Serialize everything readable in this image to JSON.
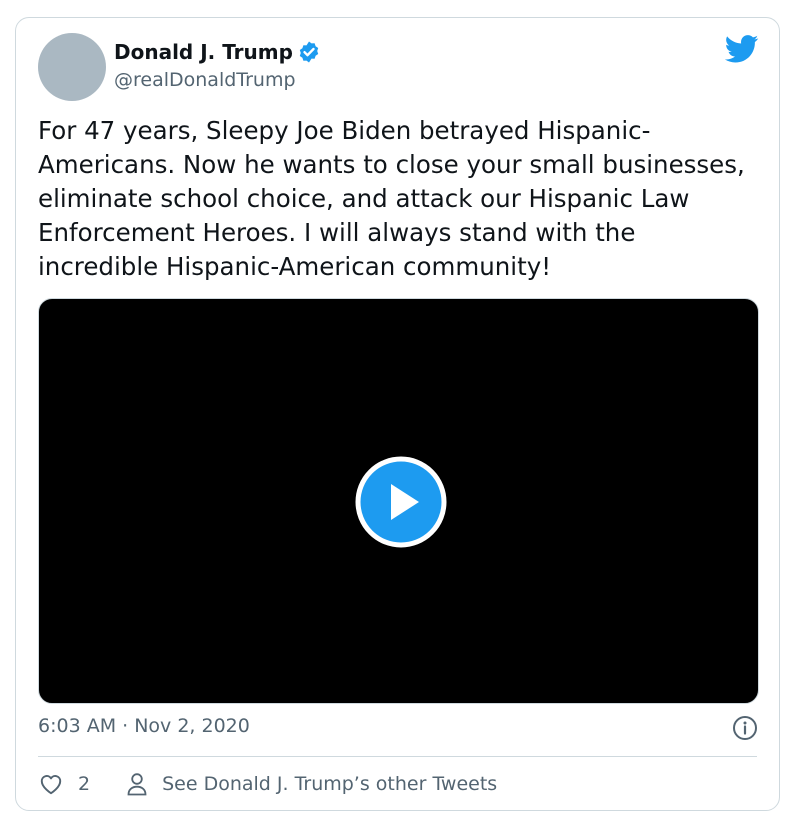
{
  "author": {
    "display_name": "Donald J. Trump",
    "handle": "@realDonaldTrump",
    "verified": true
  },
  "tweet": {
    "text": "For 47 years, Sleepy Joe Biden betrayed Hispanic-Americans. Now he wants to close your small businesses, eliminate school choice, and attack our Hispanic Law Enforcement Heroes. I will always stand with the incredible Hispanic-American community!",
    "timestamp": "6:03 AM · Nov 2, 2020"
  },
  "actions": {
    "like_count": "2",
    "see_more_label": "See Donald J. Trump’s other Tweets"
  },
  "icons": {
    "brand": "twitter-bird-icon",
    "verified": "verified-badge-icon",
    "play": "play-icon",
    "info": "info-icon",
    "like": "heart-icon",
    "profile": "person-icon"
  },
  "colors": {
    "brand_blue": "#1d9bf0",
    "text_primary": "#0f1419",
    "text_secondary": "#536471",
    "border": "#cfd9de",
    "video_bg": "#000000"
  }
}
